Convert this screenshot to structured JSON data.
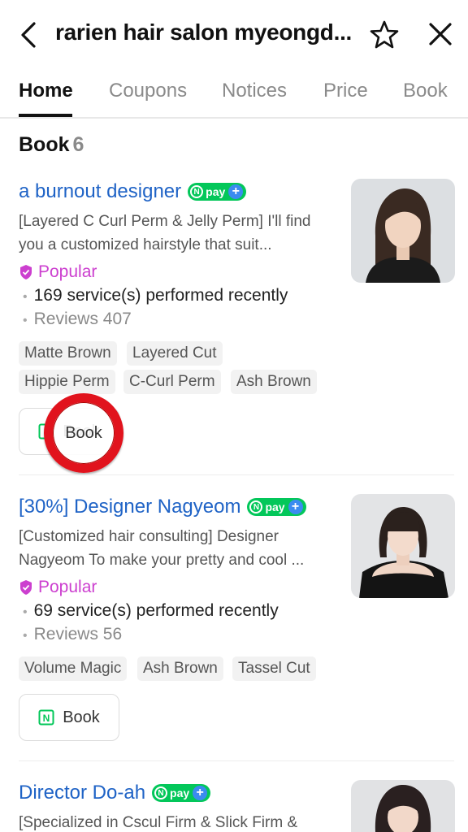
{
  "header": {
    "title": "rarien hair salon myeongd..."
  },
  "tabs": [
    {
      "label": "Home"
    },
    {
      "label": "Coupons"
    },
    {
      "label": "Notices"
    },
    {
      "label": "Price"
    },
    {
      "label": "Book"
    }
  ],
  "section": {
    "title": "Book",
    "count": "6"
  },
  "npay_label": "pay",
  "designers": [
    {
      "name": "a burnout designer",
      "description": "[Layered C Curl Perm & Jelly Perm] I'll find you a customized hairstyle that suit...",
      "badge": "Popular",
      "services": "169 service(s) performed recently",
      "reviews": "Reviews 407",
      "tags": [
        "Matte Brown",
        "Layered Cut",
        "Hippie Perm",
        "C-Curl Perm",
        "Ash Brown"
      ],
      "book_label": "Book"
    },
    {
      "name": "[30%] Designer Nagyeom",
      "description": "[Customized hair consulting] Designer Nagyeom To make your pretty and cool ...",
      "badge": "Popular",
      "services": "69 service(s) performed recently",
      "reviews": "Reviews 56",
      "tags": [
        "Volume Magic",
        "Ash Brown",
        "Tassel Cut"
      ],
      "book_label": "Book"
    },
    {
      "name": "Director Do-ah",
      "description": "[Specialized in Cscul Firm & Slick Firm &"
    }
  ],
  "colors": {
    "link_blue": "#1f63c6",
    "popular_pink": "#cc3fcf",
    "npay_green": "#03c75a",
    "click_ring_red": "#e1131d"
  }
}
